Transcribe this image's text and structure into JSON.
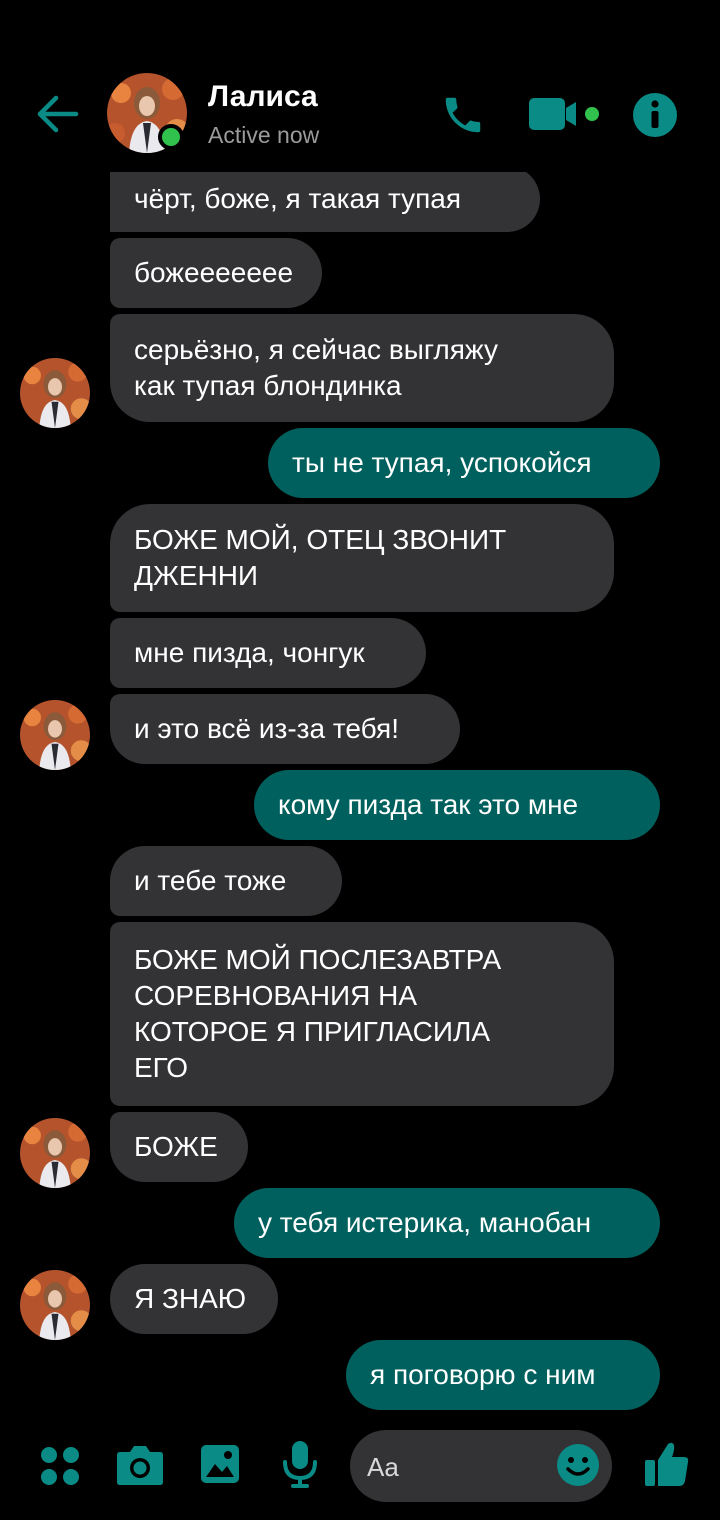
{
  "header": {
    "contact_name": "Лалиса",
    "status": "Active now",
    "icons": [
      "back-arrow-icon",
      "phone-icon",
      "video-call-icon",
      "info-icon"
    ]
  },
  "messages": [
    {
      "side": "in",
      "text": "чёрт, боже, я такая тупая"
    },
    {
      "side": "in",
      "text": "божеееееее"
    },
    {
      "side": "in",
      "text": "серьёзно, я сейчас выгляжу\nкак тупая блондинка"
    },
    {
      "side": "out",
      "text": "ты не тупая, успокойся"
    },
    {
      "side": "in",
      "text": "БОЖЕ МОЙ, ОТЕЦ ЗВОНИТ\nДЖЕННИ"
    },
    {
      "side": "in",
      "text": "мне пизда, чонгук"
    },
    {
      "side": "in",
      "text": "и это всё из-за тебя!"
    },
    {
      "side": "out",
      "text": "кому пизда так это мне"
    },
    {
      "side": "in",
      "text": "и тебе тоже"
    },
    {
      "side": "in",
      "text": "БОЖЕ МОЙ ПОСЛЕЗАВТРА\nСОРЕВНОВАНИЯ НА\nКОТОРОЕ Я ПРИГЛАСИЛА\nЕГО"
    },
    {
      "side": "in",
      "text": "БОЖЕ"
    },
    {
      "side": "out",
      "text": "у тебя истерика, манобан"
    },
    {
      "side": "in",
      "text": "Я ЗНАЮ"
    },
    {
      "side": "out",
      "text": "я поговорю с ним"
    }
  ],
  "composer": {
    "placeholder": "Aa",
    "icons": [
      "apps-icon",
      "camera-icon",
      "gallery-icon",
      "microphone-icon",
      "emoji-icon",
      "thumbs-up-icon"
    ]
  },
  "colors": {
    "accent": "#00605d",
    "incoming": "#333336",
    "icon": "#0a8b86",
    "active": "#31c24d"
  }
}
